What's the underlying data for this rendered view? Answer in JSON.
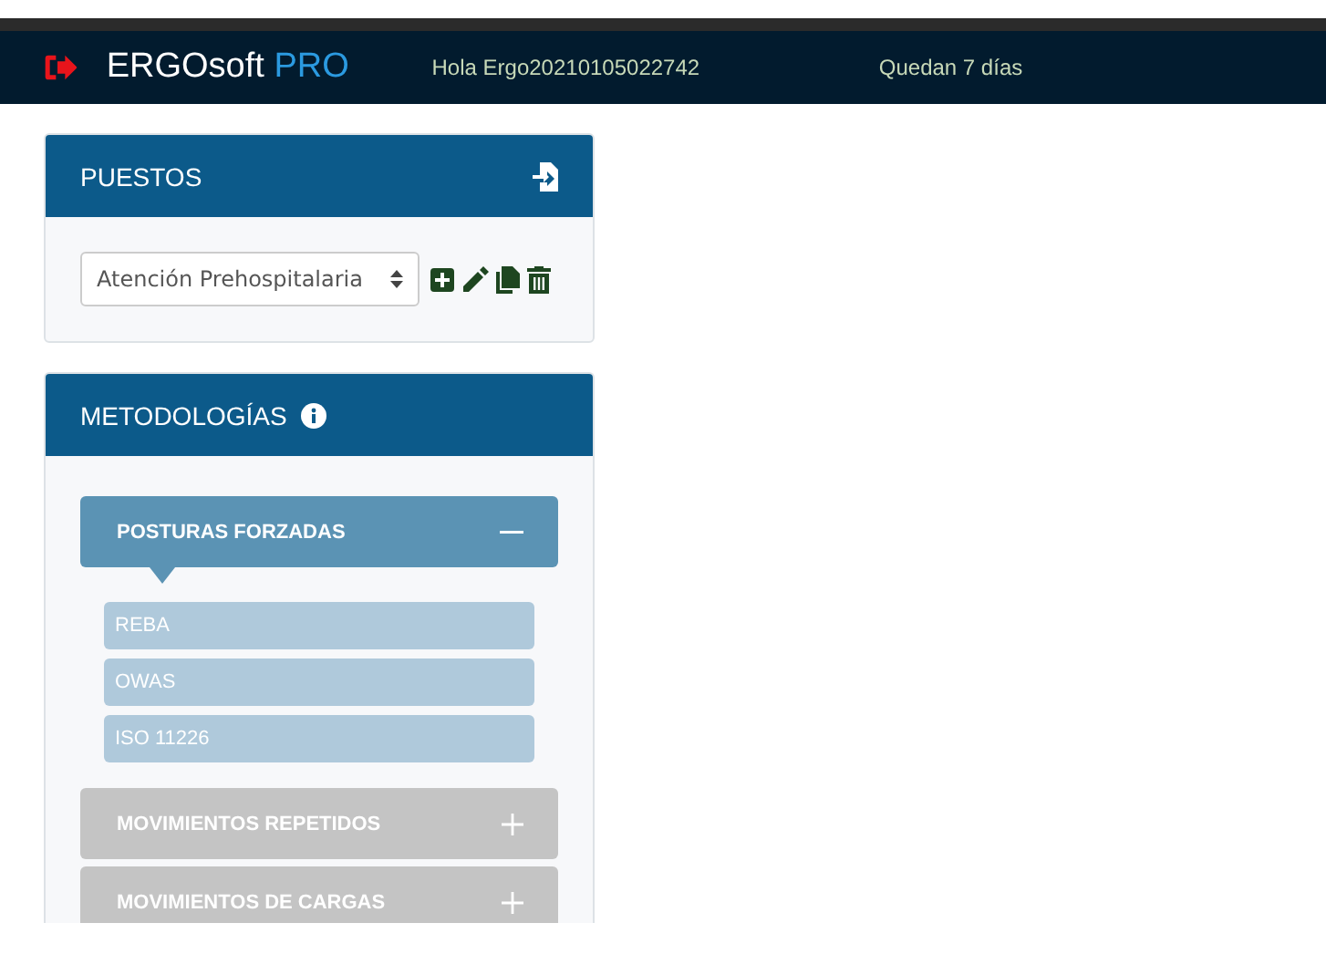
{
  "navbar": {
    "brand": "ERGOsoft",
    "brand_suffix": "PRO",
    "greeting": "Hola Ergo20210105022742",
    "trial": "Quedan 7 días"
  },
  "puestos": {
    "title": "PUESTOS",
    "select_value": "Atención Prehospitalaria"
  },
  "metodologias": {
    "title": "METODOLOGÍAS",
    "sections": [
      {
        "label": "POSTURAS FORZADAS",
        "expanded": true,
        "children": [
          {
            "label": "REBA"
          },
          {
            "label": "OWAS"
          },
          {
            "label": "ISO 11226"
          }
        ]
      },
      {
        "label": "MOVIMIENTOS REPETIDOS",
        "expanded": false
      },
      {
        "label": "MOVIMIENTOS DE CARGAS",
        "expanded": false
      }
    ]
  }
}
